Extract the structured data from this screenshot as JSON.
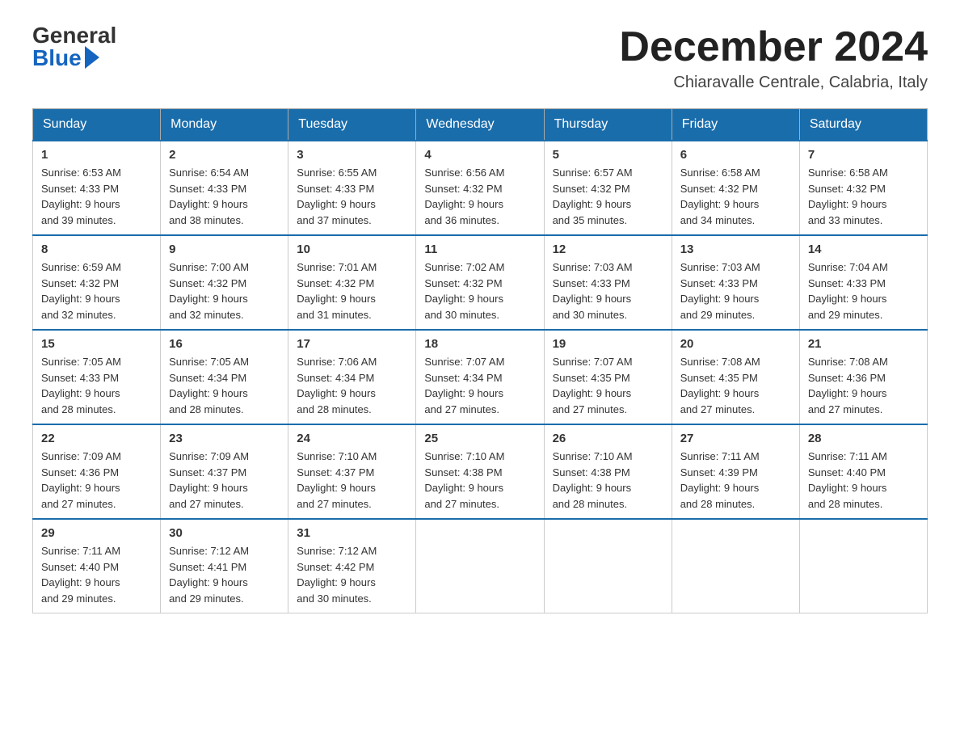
{
  "header": {
    "logo_general": "General",
    "logo_blue": "Blue",
    "month_title": "December 2024",
    "location": "Chiaravalle Centrale, Calabria, Italy"
  },
  "days_of_week": [
    "Sunday",
    "Monday",
    "Tuesday",
    "Wednesday",
    "Thursday",
    "Friday",
    "Saturday"
  ],
  "weeks": [
    [
      {
        "day": "1",
        "sunrise": "6:53 AM",
        "sunset": "4:33 PM",
        "daylight": "9 hours and 39 minutes."
      },
      {
        "day": "2",
        "sunrise": "6:54 AM",
        "sunset": "4:33 PM",
        "daylight": "9 hours and 38 minutes."
      },
      {
        "day": "3",
        "sunrise": "6:55 AM",
        "sunset": "4:33 PM",
        "daylight": "9 hours and 37 minutes."
      },
      {
        "day": "4",
        "sunrise": "6:56 AM",
        "sunset": "4:32 PM",
        "daylight": "9 hours and 36 minutes."
      },
      {
        "day": "5",
        "sunrise": "6:57 AM",
        "sunset": "4:32 PM",
        "daylight": "9 hours and 35 minutes."
      },
      {
        "day": "6",
        "sunrise": "6:58 AM",
        "sunset": "4:32 PM",
        "daylight": "9 hours and 34 minutes."
      },
      {
        "day": "7",
        "sunrise": "6:58 AM",
        "sunset": "4:32 PM",
        "daylight": "9 hours and 33 minutes."
      }
    ],
    [
      {
        "day": "8",
        "sunrise": "6:59 AM",
        "sunset": "4:32 PM",
        "daylight": "9 hours and 32 minutes."
      },
      {
        "day": "9",
        "sunrise": "7:00 AM",
        "sunset": "4:32 PM",
        "daylight": "9 hours and 32 minutes."
      },
      {
        "day": "10",
        "sunrise": "7:01 AM",
        "sunset": "4:32 PM",
        "daylight": "9 hours and 31 minutes."
      },
      {
        "day": "11",
        "sunrise": "7:02 AM",
        "sunset": "4:32 PM",
        "daylight": "9 hours and 30 minutes."
      },
      {
        "day": "12",
        "sunrise": "7:03 AM",
        "sunset": "4:33 PM",
        "daylight": "9 hours and 30 minutes."
      },
      {
        "day": "13",
        "sunrise": "7:03 AM",
        "sunset": "4:33 PM",
        "daylight": "9 hours and 29 minutes."
      },
      {
        "day": "14",
        "sunrise": "7:04 AM",
        "sunset": "4:33 PM",
        "daylight": "9 hours and 29 minutes."
      }
    ],
    [
      {
        "day": "15",
        "sunrise": "7:05 AM",
        "sunset": "4:33 PM",
        "daylight": "9 hours and 28 minutes."
      },
      {
        "day": "16",
        "sunrise": "7:05 AM",
        "sunset": "4:34 PM",
        "daylight": "9 hours and 28 minutes."
      },
      {
        "day": "17",
        "sunrise": "7:06 AM",
        "sunset": "4:34 PM",
        "daylight": "9 hours and 28 minutes."
      },
      {
        "day": "18",
        "sunrise": "7:07 AM",
        "sunset": "4:34 PM",
        "daylight": "9 hours and 27 minutes."
      },
      {
        "day": "19",
        "sunrise": "7:07 AM",
        "sunset": "4:35 PM",
        "daylight": "9 hours and 27 minutes."
      },
      {
        "day": "20",
        "sunrise": "7:08 AM",
        "sunset": "4:35 PM",
        "daylight": "9 hours and 27 minutes."
      },
      {
        "day": "21",
        "sunrise": "7:08 AM",
        "sunset": "4:36 PM",
        "daylight": "9 hours and 27 minutes."
      }
    ],
    [
      {
        "day": "22",
        "sunrise": "7:09 AM",
        "sunset": "4:36 PM",
        "daylight": "9 hours and 27 minutes."
      },
      {
        "day": "23",
        "sunrise": "7:09 AM",
        "sunset": "4:37 PM",
        "daylight": "9 hours and 27 minutes."
      },
      {
        "day": "24",
        "sunrise": "7:10 AM",
        "sunset": "4:37 PM",
        "daylight": "9 hours and 27 minutes."
      },
      {
        "day": "25",
        "sunrise": "7:10 AM",
        "sunset": "4:38 PM",
        "daylight": "9 hours and 27 minutes."
      },
      {
        "day": "26",
        "sunrise": "7:10 AM",
        "sunset": "4:38 PM",
        "daylight": "9 hours and 28 minutes."
      },
      {
        "day": "27",
        "sunrise": "7:11 AM",
        "sunset": "4:39 PM",
        "daylight": "9 hours and 28 minutes."
      },
      {
        "day": "28",
        "sunrise": "7:11 AM",
        "sunset": "4:40 PM",
        "daylight": "9 hours and 28 minutes."
      }
    ],
    [
      {
        "day": "29",
        "sunrise": "7:11 AM",
        "sunset": "4:40 PM",
        "daylight": "9 hours and 29 minutes."
      },
      {
        "day": "30",
        "sunrise": "7:12 AM",
        "sunset": "4:41 PM",
        "daylight": "9 hours and 29 minutes."
      },
      {
        "day": "31",
        "sunrise": "7:12 AM",
        "sunset": "4:42 PM",
        "daylight": "9 hours and 30 minutes."
      },
      null,
      null,
      null,
      null
    ]
  ],
  "labels": {
    "sunrise_prefix": "Sunrise: ",
    "sunset_prefix": "Sunset: ",
    "daylight_prefix": "Daylight: "
  }
}
